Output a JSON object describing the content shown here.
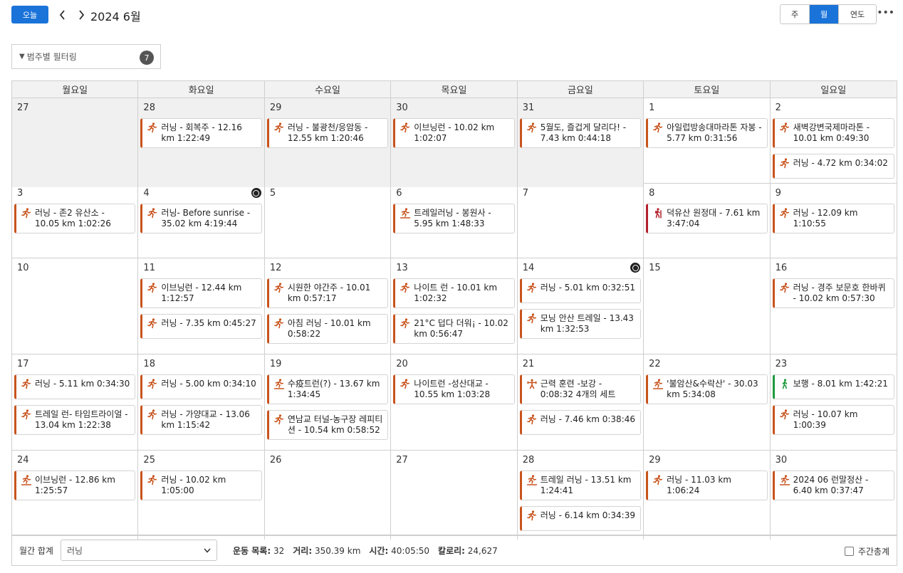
{
  "header": {
    "today_label": "오늘",
    "period_title": "2024 6월",
    "views": [
      "주",
      "월",
      "연도"
    ],
    "active_view": "월",
    "more_label": "•••"
  },
  "filter": {
    "label": "범주별 필터링",
    "count": "7"
  },
  "weekdays": [
    "월요일",
    "화요일",
    "수요일",
    "목요일",
    "금요일",
    "토요일",
    "일요일"
  ],
  "weeks": [
    {
      "height": 120,
      "days": [
        {
          "num": "27",
          "prev": true,
          "events": []
        },
        {
          "num": "28",
          "prev": true,
          "events": [
            {
              "icon": "run",
              "text": "러닝 - 회복주 - 12.16 km 1:22:49"
            }
          ]
        },
        {
          "num": "29",
          "prev": true,
          "events": [
            {
              "icon": "run",
              "text": "러닝 - 불광천/응암동 - 12.55 km 1:20:46"
            }
          ]
        },
        {
          "num": "30",
          "prev": true,
          "events": [
            {
              "icon": "run",
              "text": "이브닝런 - 10.02 km 1:02:07"
            }
          ]
        },
        {
          "num": "31",
          "prev": true,
          "events": [
            {
              "icon": "run",
              "text": "5월도, 즐겁게 달리다! - 7.43 km 0:44:18"
            }
          ]
        },
        {
          "num": "1",
          "events": [
            {
              "icon": "run",
              "text": "아일럽방송대마라톤 자봉 - 5.77 km 0:31:56"
            }
          ]
        },
        {
          "num": "2",
          "events": [
            {
              "icon": "run",
              "text": "새벽강변국제마라톤 - 10.01 km 0:49:30"
            },
            {
              "icon": "run",
              "text": "러닝 - 4.72 km 0:34:02"
            }
          ]
        }
      ]
    },
    {
      "height": 105,
      "days": [
        {
          "num": "3",
          "events": [
            {
              "icon": "run",
              "text": "러닝 - 존2 유산소 - 10.05 km 1:02:26"
            }
          ]
        },
        {
          "num": "4",
          "badge": true,
          "events": [
            {
              "icon": "run",
              "text": "러닝- Before sunrise - 35.02 km 4:19:44"
            }
          ]
        },
        {
          "num": "5",
          "events": []
        },
        {
          "num": "6",
          "events": [
            {
              "icon": "trail",
              "text": "트레일러닝 - 봉원사 - 5.95 km 1:48:33"
            }
          ]
        },
        {
          "num": "7",
          "events": []
        },
        {
          "num": "8",
          "events": [
            {
              "icon": "hike",
              "text": "덕유산 원정대 - 7.61 km 3:47:04"
            }
          ]
        },
        {
          "num": "9",
          "events": [
            {
              "icon": "run",
              "text": "러닝 - 12.09 km 1:10:55"
            }
          ]
        }
      ]
    },
    {
      "height": 135,
      "days": [
        {
          "num": "10",
          "events": []
        },
        {
          "num": "11",
          "events": [
            {
              "icon": "run",
              "text": "이브닝런 - 12.44 km 1:12:57"
            },
            {
              "icon": "run",
              "text": "러닝 - 7.35 km 0:45:27"
            }
          ]
        },
        {
          "num": "12",
          "events": [
            {
              "icon": "run",
              "text": "시원한 야간주 - 10.01 km 0:57:17"
            },
            {
              "icon": "run",
              "text": "아침 러닝 - 10.01 km 0:58:22"
            }
          ]
        },
        {
          "num": "13",
          "events": [
            {
              "icon": "run",
              "text": "나이트 런 - 10.01 km 1:02:32"
            },
            {
              "icon": "run",
              "text": "21°C 덥다 더워¡ - 10.02 km 0:56:47"
            }
          ]
        },
        {
          "num": "14",
          "badge": true,
          "events": [
            {
              "icon": "run",
              "text": "러닝 - 5.01 km 0:32:51"
            },
            {
              "icon": "run",
              "text": "모닝 안산 트레일 - 13.43 km 1:32:53"
            }
          ]
        },
        {
          "num": "15",
          "events": []
        },
        {
          "num": "16",
          "events": [
            {
              "icon": "run",
              "text": "러닝 - 경주 보문호 한바퀴 - 10.02 km 0:57:30"
            }
          ]
        }
      ]
    },
    {
      "height": 135,
      "days": [
        {
          "num": "17",
          "events": [
            {
              "icon": "run",
              "text": "러닝 - 5.11 km 0:34:30"
            },
            {
              "icon": "run",
              "text": "트레일 런- 타임트라이얼 - 13.04 km 1:22:38"
            }
          ]
        },
        {
          "num": "18",
          "events": [
            {
              "icon": "run",
              "text": "러닝 - 5.00 km 0:34:10"
            },
            {
              "icon": "run",
              "text": "러닝 - 가양대교 - 13.06 km 1:15:42"
            }
          ]
        },
        {
          "num": "19",
          "events": [
            {
              "icon": "trail",
              "text": "수疫트런(?) - 13.67 km 1:34:45"
            },
            {
              "icon": "run",
              "text": "연남교 터널-농구장 레피티션 - 10.54 km 0:58:52"
            }
          ]
        },
        {
          "num": "20",
          "events": [
            {
              "icon": "run",
              "text": "나이트런 -성산대교 - 10.55 km 1:03:28"
            }
          ]
        },
        {
          "num": "21",
          "events": [
            {
              "icon": "strength",
              "text": "근력 훈련 -보강 - 0:08:32 4개의 세트"
            },
            {
              "icon": "run",
              "text": "러닝 - 7.46 km 0:38:46"
            }
          ]
        },
        {
          "num": "22",
          "events": [
            {
              "icon": "trail",
              "text": "'불암산&수락산' - 30.03 km 5:34:08"
            }
          ]
        },
        {
          "num": "23",
          "events": [
            {
              "icon": "walk",
              "text": "보행 - 8.01 km 1:42:21"
            },
            {
              "icon": "run",
              "text": "러닝 - 10.07 km 1:00:39"
            }
          ]
        }
      ]
    },
    {
      "height": 120,
      "days": [
        {
          "num": "24",
          "events": [
            {
              "icon": "trail",
              "text": "이브닝런 - 12.86 km 1:25:57"
            }
          ]
        },
        {
          "num": "25",
          "events": [
            {
              "icon": "run",
              "text": "러닝 - 10.02 km 1:05:00"
            }
          ]
        },
        {
          "num": "26",
          "events": []
        },
        {
          "num": "27",
          "events": []
        },
        {
          "num": "28",
          "events": [
            {
              "icon": "trail",
              "text": "트레일 러닝 - 13.51 km 1:24:41"
            },
            {
              "icon": "run",
              "text": "러닝 - 6.14 km 0:34:39"
            }
          ]
        },
        {
          "num": "29",
          "events": [
            {
              "icon": "run",
              "text": "러닝 - 11.03 km 1:06:24"
            }
          ]
        },
        {
          "num": "30",
          "events": [
            {
              "icon": "trail",
              "text": "2024 06 런말정산 - 6.40 km 0:37:47"
            }
          ]
        }
      ]
    }
  ],
  "footer": {
    "monthly_total_label": "월간 합계",
    "activity_select": "러닝",
    "stats": [
      {
        "label": "운동 목록:",
        "value": "32"
      },
      {
        "label": "거리:",
        "value": "350.39 km"
      },
      {
        "label": "시간:",
        "value": "40:05:50"
      },
      {
        "label": "칼로리:",
        "value": "24,627"
      }
    ],
    "weekly_total_label": "주간총계"
  },
  "colors": {
    "accent": "#1a73d9",
    "run": "#c8531d",
    "hike": "#b3212c",
    "walk": "#1f9a3d"
  }
}
